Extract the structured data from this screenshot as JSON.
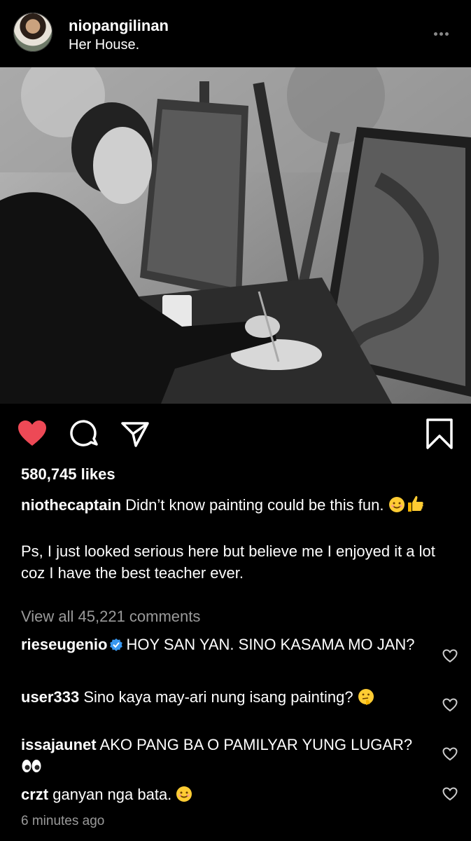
{
  "post": {
    "username": "niopangilinan",
    "location": "Her House.",
    "likes": "580,745 likes",
    "caption": {
      "user": "niothecaptain",
      "line1": "Didn’t know painting could be this fun.",
      "line2": "Ps, I just looked serious here but believe me I enjoyed it a lot coz I have the best teacher ever."
    },
    "view_all_comments": "View all 45,221 comments",
    "time_ago": "6 minutes ago"
  },
  "comments": [
    {
      "user": "rieseugenio",
      "verified": true,
      "text": "HOY SAN YAN. SINO KASAMA MO JAN?"
    },
    {
      "user": "user333",
      "verified": false,
      "text": "Sino kaya may-ari nung isang painting?"
    },
    {
      "user": "issajaunet",
      "verified": false,
      "text": "AKO PANG BA O PAMILYAR YUNG LUGAR?"
    },
    {
      "user": "crzt",
      "verified": false,
      "text": "ganyan nga bata."
    }
  ],
  "colors": {
    "background": "#000000",
    "like_red": "#ED4956",
    "verified_blue": "#3897F0",
    "muted": "#9a9a9a"
  },
  "icons": [
    "more-options-icon",
    "heart-filled-icon",
    "comment-icon",
    "share-icon",
    "bookmark-icon",
    "verified-icon",
    "heart-outline-icon"
  ]
}
